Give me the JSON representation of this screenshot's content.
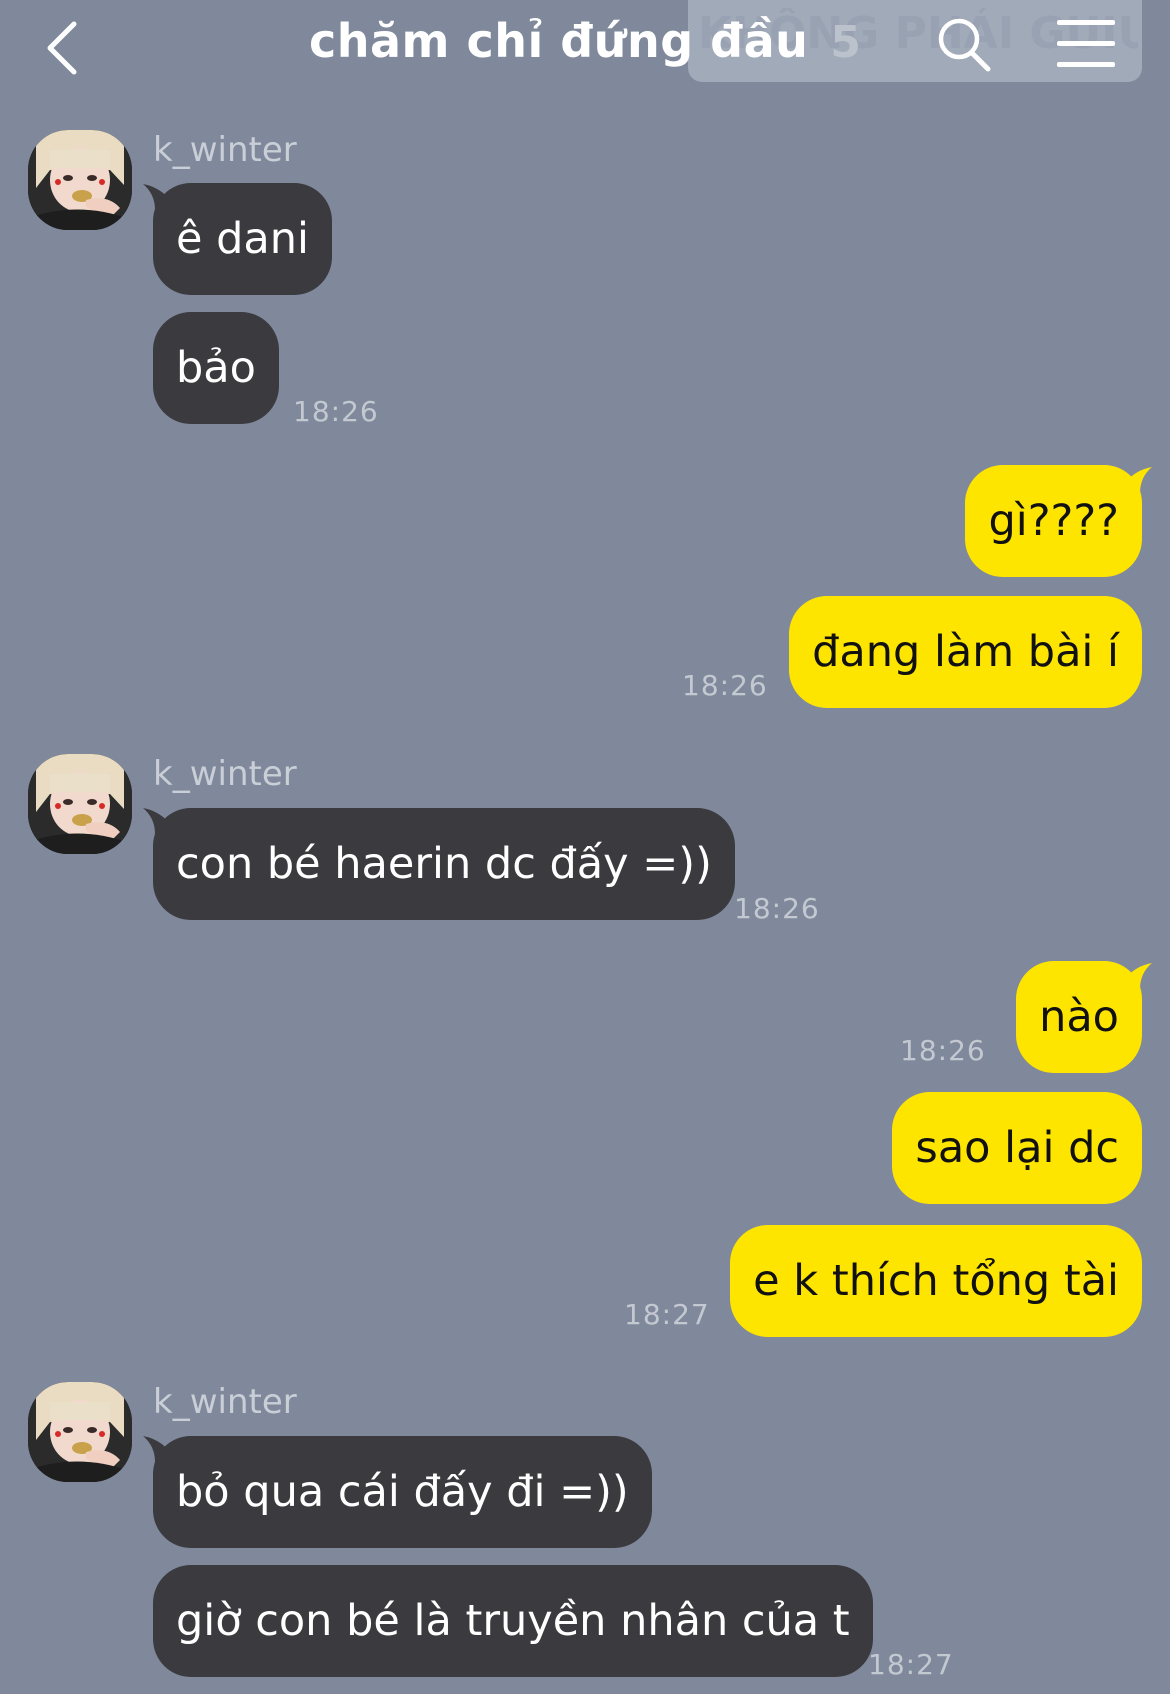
{
  "header": {
    "title": "chăm chỉ đứng đầu",
    "member_count": "5",
    "watermark": "KHÔNG PHẢI GUIU"
  },
  "messages": [
    {
      "sender": "k_winter",
      "text": "ê dani"
    },
    {
      "text": "bảo",
      "time": "18:26"
    },
    {
      "text": "gì????"
    },
    {
      "text": "đang làm bài í",
      "time": "18:26"
    },
    {
      "sender": "k_winter",
      "text": "con bé haerin dc đấy =))",
      "time": "18:26"
    },
    {
      "text": "nào",
      "time": "18:26"
    },
    {
      "text": "sao lại dc"
    },
    {
      "text": "e k thích tổng tài",
      "time": "18:27"
    },
    {
      "sender": "k_winter",
      "text": "bỏ qua cái đấy đi =))"
    },
    {
      "text": "giờ con bé là truyền nhân của t",
      "time": "18:27"
    }
  ],
  "colors": {
    "background": "#7f899b",
    "incoming_bubble": "#3b3b3f",
    "outgoing_bubble": "#fee500"
  },
  "icons": [
    "back-chevron-icon",
    "search-icon",
    "hamburger-menu-icon"
  ]
}
